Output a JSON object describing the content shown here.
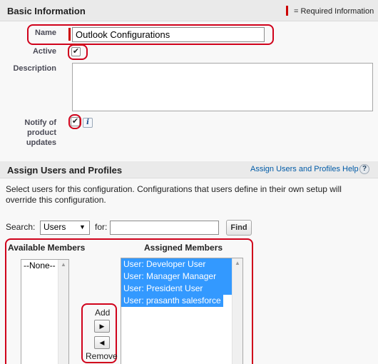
{
  "basic_info": {
    "title": "Basic Information",
    "required_legend": "= Required Information"
  },
  "form": {
    "name_label": "Name",
    "name_value": "Outlook Configurations",
    "active_label": "Active",
    "active_checked": true,
    "description_label": "Description",
    "description_value": "",
    "notify_label_line1": "Notify of",
    "notify_label_line2": "product",
    "notify_label_line3": "updates",
    "notify_checked": true,
    "info_icon_text": "i"
  },
  "assign": {
    "title": "Assign Users and Profiles",
    "help_link": "Assign Users and Profiles Help",
    "help_icon_text": "?",
    "description_line1": "Select users for this configuration. Configurations that users define in their own setup will",
    "description_line2": "override this configuration.",
    "search_label": "Search:",
    "search_select_value": "Users",
    "for_label": "for:",
    "search_input_value": "",
    "find_button": "Find",
    "available_title": "Available Members",
    "assigned_title": "Assigned Members",
    "available_options": [
      "--None--"
    ],
    "assigned_options": [
      "User: Developer User",
      "User: Manager Manager",
      "User: President User",
      "User: prasanth salesforce"
    ],
    "add_label": "Add",
    "remove_label": "Remove"
  },
  "colors": {
    "highlight": "#d0021b",
    "required": "#cc0000",
    "selected_option": "#3399ff"
  }
}
